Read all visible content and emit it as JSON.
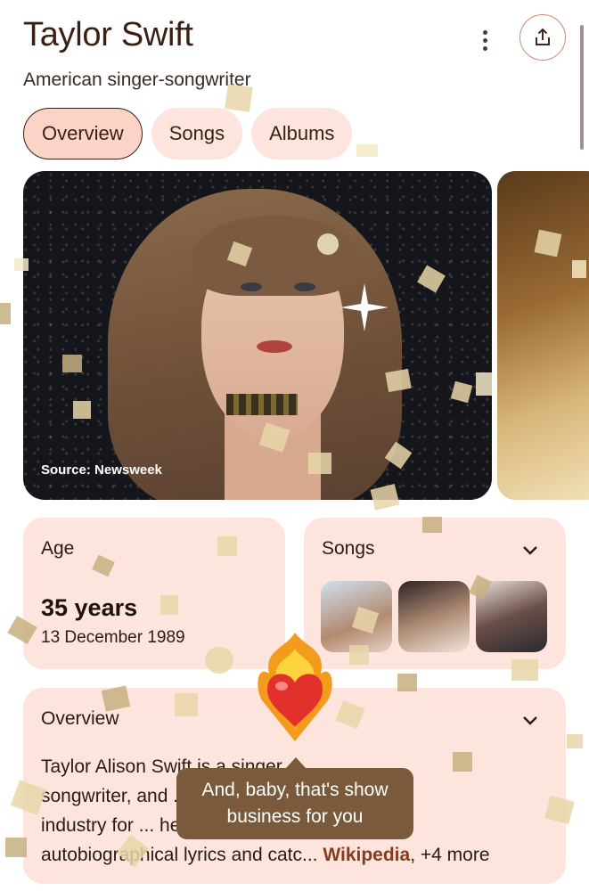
{
  "header": {
    "title": "Taylor Swift",
    "subtitle": "American singer-songwriter",
    "more_icon": "more-vert-icon",
    "share_icon": "share-icon"
  },
  "tabs": [
    {
      "label": "Overview",
      "active": true
    },
    {
      "label": "Songs",
      "active": false
    },
    {
      "label": "Albums",
      "active": false
    }
  ],
  "hero": {
    "caption": "Source: Newsweek"
  },
  "age_card": {
    "title": "Age",
    "value": "35 years",
    "date": "13 December 1989"
  },
  "songs_card": {
    "title": "Songs",
    "chevron_icon": "chevron-down-icon"
  },
  "overview_card": {
    "title": "Overview",
    "line1": "Taylor Alison Swift is a singer,",
    "line2": "songwriter, and ... the music",
    "line3": "industry for ... her",
    "line4_start": "autobiographical lyrics and catc",
    "ellipsis": "...",
    "link": "Wikipedia",
    "more": ", +4 more"
  },
  "tooltip": {
    "text": "And, baby, that's show business for you"
  },
  "colors": {
    "card_bg": "#fde4dc",
    "active_tab_bg": "#fcd3c7",
    "title": "#3a1f14",
    "link": "#8a3a1c",
    "tooltip_bg": "#7a5a3a",
    "share_border": "#c98a74"
  }
}
